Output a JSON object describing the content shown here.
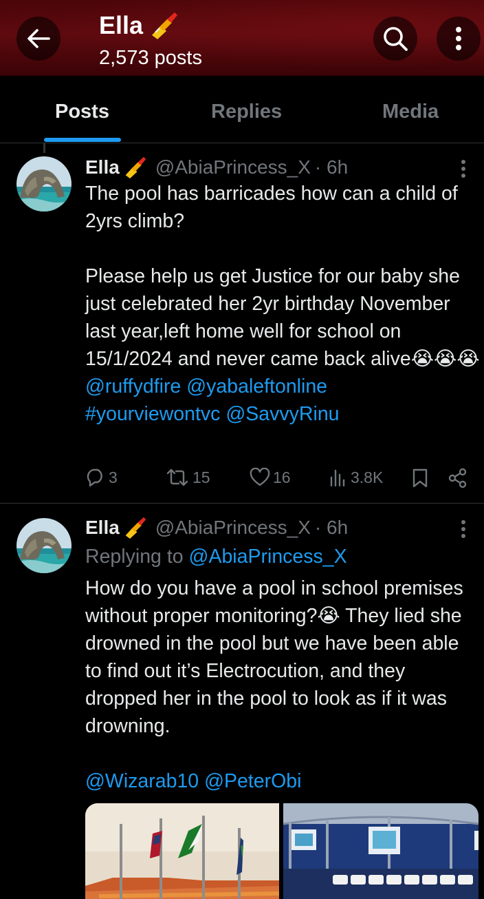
{
  "header": {
    "name": "Ella",
    "posts_count": "2,573 posts",
    "background_color": "#5e0a0f"
  },
  "tabs": [
    {
      "label": "Posts",
      "active": true
    },
    {
      "label": "Replies",
      "active": false
    },
    {
      "label": "Media",
      "active": false
    }
  ],
  "accent_color": "#1d9bf0",
  "tweets": [
    {
      "name": "Ella",
      "handle": "@AbiaPrincess_X",
      "time": "· 6h",
      "text_main": "The pool has barricades how can a child of 2yrs climb?\n\nPlease help us get Justice for our baby she just celebrated her 2yr birthday November last year,left home well for school on 15/1/2024 and never came back alive😭😭😭",
      "links": [
        "@ruffydfire",
        "@yabaleftonline",
        "#yourviewontvc",
        "@SavvyRinu"
      ],
      "replies": "3",
      "reposts": "15",
      "likes": "16",
      "views": "3.8K"
    },
    {
      "name": "Ella",
      "handle": "@AbiaPrincess_X",
      "time": "· 6h",
      "replying_prefix": "Replying to",
      "replying_to": "@AbiaPrincess_X",
      "text_main": "How do you have a pool in school premises without proper monitoring?😭 They lied she drowned in the pool but we have been able to find out it’s Electrocution, and they dropped her in the pool to look as if it was drowning.",
      "links": [
        "@Wizarab10",
        "@PeterObi"
      ]
    }
  ]
}
